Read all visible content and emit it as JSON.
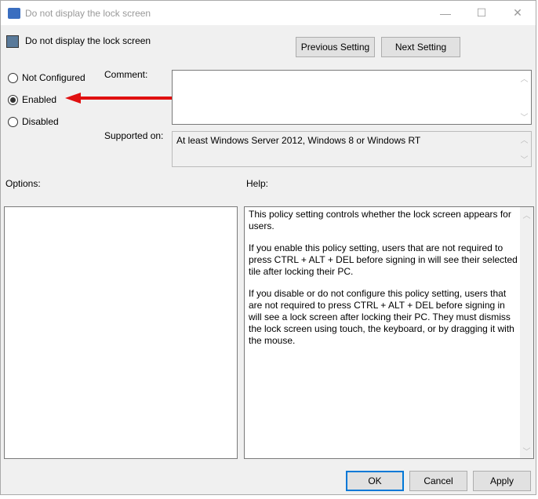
{
  "window": {
    "title": "Do not display the lock screen",
    "controls": {
      "minimize": "—",
      "maximize": "☐",
      "close": "✕"
    }
  },
  "header": {
    "policy_name": "Do not display the lock screen",
    "previous_setting": "Previous Setting",
    "next_setting": "Next Setting"
  },
  "state": {
    "options": [
      {
        "label": "Not Configured",
        "selected": false
      },
      {
        "label": "Enabled",
        "selected": true
      },
      {
        "label": "Disabled",
        "selected": false
      }
    ]
  },
  "comment": {
    "label": "Comment:",
    "value": ""
  },
  "supported": {
    "label": "Supported on:",
    "value": "At least Windows Server 2012, Windows 8 or Windows RT"
  },
  "options_panel": {
    "label": "Options:"
  },
  "help": {
    "label": "Help:",
    "paragraphs": [
      "This policy setting controls whether the lock screen appears for users.",
      "If you enable this policy setting, users that are not required to press CTRL + ALT + DEL before signing in will see their selected tile after locking their PC.",
      "If you disable or do not configure this policy setting, users that are not required to press CTRL + ALT + DEL before signing in will see a lock screen after locking their PC. They must dismiss the lock screen using touch, the keyboard, or by dragging it with the mouse."
    ]
  },
  "footer": {
    "ok": "OK",
    "cancel": "Cancel",
    "apply": "Apply"
  },
  "colors": {
    "annotation_arrow": "#e01010",
    "focus": "#0078d7"
  }
}
